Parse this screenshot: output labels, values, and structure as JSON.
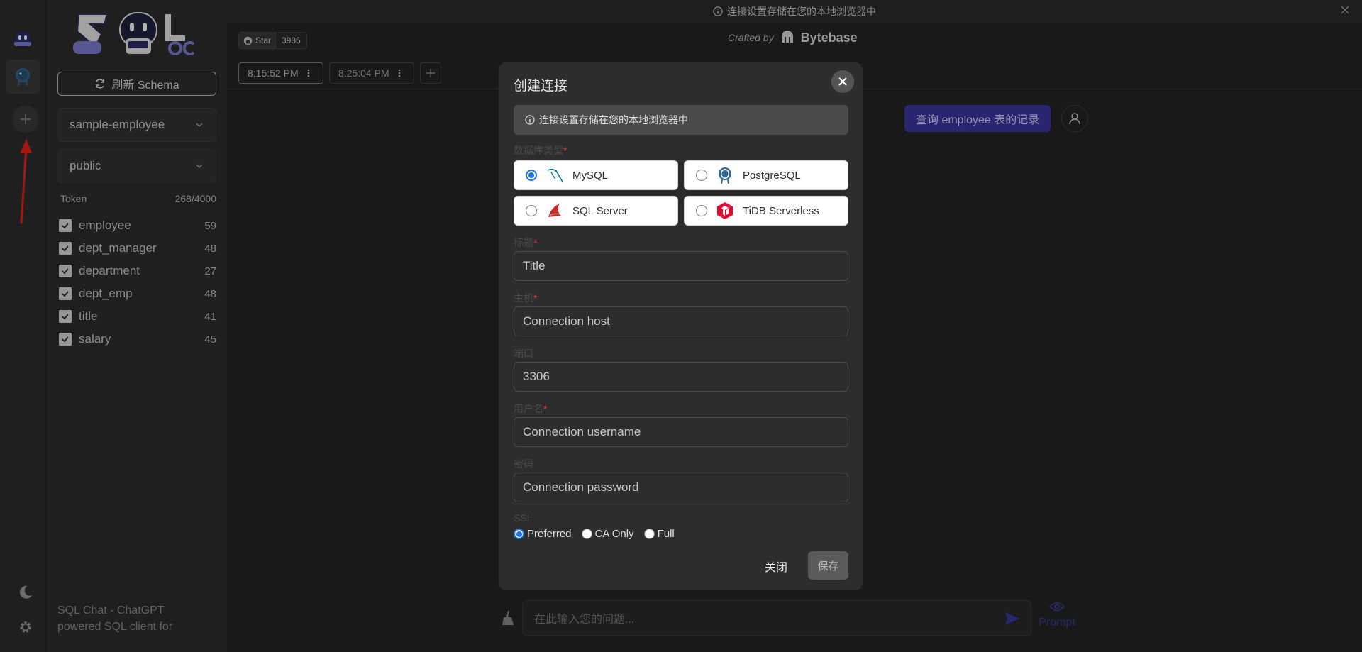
{
  "banner": {
    "text": "连接设置存储在您的本地浏览器中"
  },
  "sidebar": {
    "refresh_label": "刷新 Schema",
    "database_select": "sample-employee",
    "schema_select": "public",
    "token_label": "Token",
    "token_value": "268/4000",
    "tables": [
      {
        "name": "employee",
        "count": "59"
      },
      {
        "name": "dept_manager",
        "count": "48"
      },
      {
        "name": "department",
        "count": "27"
      },
      {
        "name": "dept_emp",
        "count": "48"
      },
      {
        "name": "title",
        "count": "41"
      },
      {
        "name": "salary",
        "count": "45"
      }
    ],
    "broken_image_alt": "SQL Chat - ChatGPT powered SQL client for"
  },
  "header": {
    "star_label": "Star",
    "star_count": "3986",
    "crafted_by": "Crafted by",
    "brand": "Bytebase"
  },
  "tabs": [
    {
      "label": "8:15:52 PM"
    },
    {
      "label": "8:25:04 PM"
    }
  ],
  "chat": {
    "user_message": "查询 employee 表的记录",
    "input_placeholder": "在此输入您的问题...",
    "prompt_label": "Prompt"
  },
  "modal": {
    "title": "创建连接",
    "info": "连接设置存储在您的本地浏览器中",
    "db_type_label": "数据库类型",
    "db_types": [
      "MySQL",
      "PostgreSQL",
      "SQL Server",
      "TiDB Serverless"
    ],
    "selected_db": "MySQL",
    "title_label": "标题",
    "title_placeholder": "Title",
    "host_label": "主机",
    "host_placeholder": "Connection host",
    "port_label": "端口",
    "port_value": "3306",
    "username_label": "用户名",
    "username_placeholder": "Connection username",
    "password_label": "密码",
    "password_placeholder": "Connection password",
    "ssl_label": "SSL",
    "ssl_options": [
      "Preferred",
      "CA Only",
      "Full"
    ],
    "ssl_selected": "Preferred",
    "close_label": "关闭",
    "save_label": "保存",
    "required_mark": "*"
  },
  "colors": {
    "accent": "#3a35a3",
    "radio_selected": "#1a73e8",
    "required": "#e63a3a",
    "annotation_arrow": "#e8241c"
  }
}
